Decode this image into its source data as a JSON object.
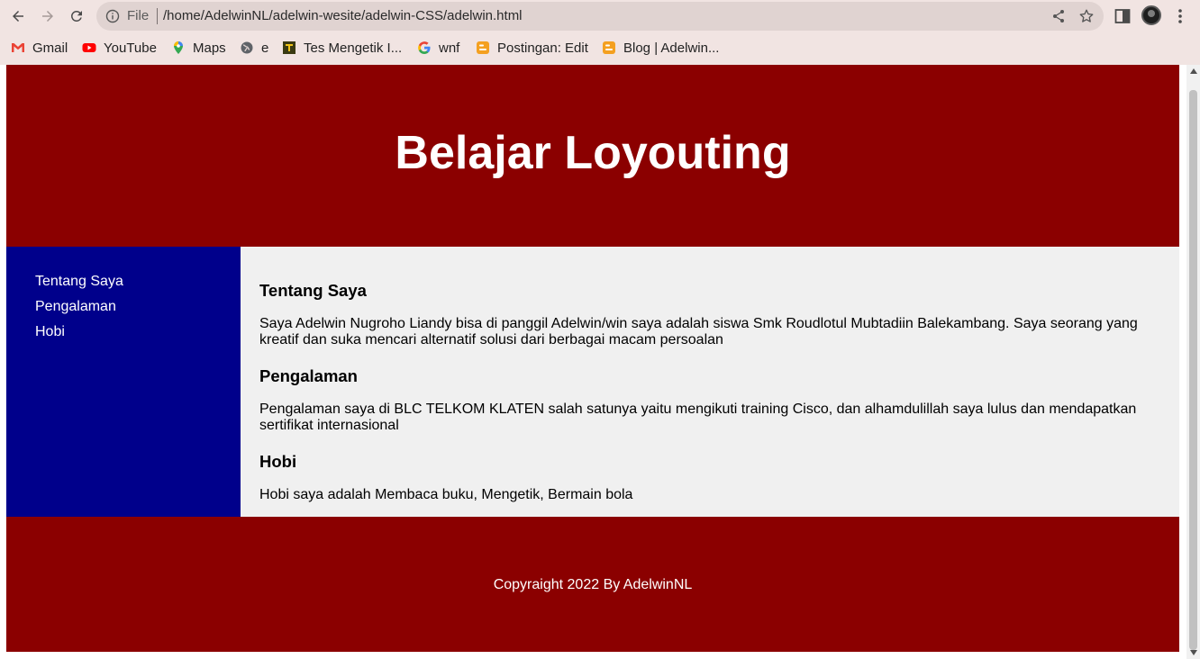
{
  "browser": {
    "address": {
      "scheme": "File",
      "url": "/home/AdelwinNL/adelwin-wesite/adelwin-CSS/adelwin.html"
    },
    "bookmarks": [
      {
        "label": "Gmail",
        "icon": "gmail-icon"
      },
      {
        "label": "YouTube",
        "icon": "youtube-icon"
      },
      {
        "label": "Maps",
        "icon": "maps-icon"
      },
      {
        "label": "e",
        "icon": "globe-icon"
      },
      {
        "label": "Tes Mengetik I...",
        "icon": "typing-test-icon"
      },
      {
        "label": "wnf",
        "icon": "google-icon"
      },
      {
        "label": "Postingan: Edit",
        "icon": "blogger-icon"
      },
      {
        "label": "Blog | Adelwin...",
        "icon": "blogger-icon"
      }
    ]
  },
  "header": {
    "title": "Belajar Loyouting"
  },
  "sidebar": {
    "items": [
      {
        "label": "Tentang Saya"
      },
      {
        "label": "Pengalaman"
      },
      {
        "label": "Hobi"
      }
    ]
  },
  "content": {
    "sections": [
      {
        "heading": "Tentang Saya",
        "text": "Saya Adelwin Nugroho Liandy bisa di panggil Adelwin/win saya adalah siswa Smk Roudlotul Mubtadiin Balekambang. Saya seorang yang kreatif dan suka mencari alternatif solusi dari berbagai macam persoalan"
      },
      {
        "heading": "Pengalaman",
        "text": "Pengalaman saya di BLC TELKOM KLATEN salah satunya yaitu mengikuti training Cisco, dan alhamdulillah saya lulus dan mendapatkan sertifikat internasional"
      },
      {
        "heading": "Hobi",
        "text": "Hobi saya adalah Membaca buku, Mengetik, Bermain bola"
      }
    ]
  },
  "footer": {
    "text": "Copyraight 2022 By AdelwinNL"
  },
  "colors": {
    "header_bg": "#8b0000",
    "sidebar_bg": "#00008b",
    "content_bg": "#f0f0f0",
    "browser_chrome": "#f1e4e2"
  }
}
